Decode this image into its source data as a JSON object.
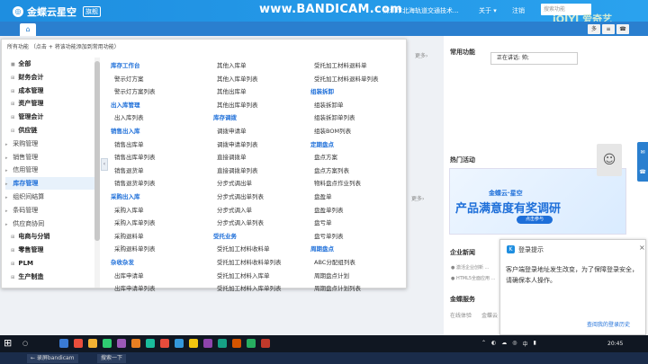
{
  "header": {
    "logo": "金蝶云星空",
    "badge": "旗舰",
    "recorder_watermark": "www.BANDICAM.com",
    "company": "深圳市北海轨道交通技术...",
    "about": "关于 ▾",
    "logout": "注销",
    "search_placeholder": "搜索功能",
    "video_watermark": "iQIYI 爱奇艺"
  },
  "tabbar": {
    "home_icon": "home-icon",
    "tool_labels": [
      "多",
      "≡",
      "☎"
    ]
  },
  "right_panel": {
    "common_title": "常用功能",
    "call_text": "正在讲话: 帅;",
    "more_label": "更多›",
    "hot_title": "热门活动",
    "banner_logo": "金蝶云·星空",
    "banner_text": "产品满意度有奖调研",
    "banner_btn": "点击参与",
    "news_title": "企业新闻",
    "news_items": [
      "● 激活企业创新 ...",
      "● HTML5全面应用 ..."
    ],
    "service_title": "金蝶服务",
    "service_items": [
      "在线体验",
      "金蝶云"
    ]
  },
  "popup": {
    "title": "登录提示",
    "close": "×",
    "body": "客户端登录地址发生改变，为了保障登录安全，请确保本人操作。",
    "link": "查阅我的登录历史"
  },
  "menu_panel": {
    "hint": "所有功能  （点击 + 将该功能添加到常用功能）",
    "nav": [
      {
        "label": "全部",
        "level": "child",
        "mark": "■"
      },
      {
        "label": "财务会计",
        "level": "child",
        "mark": "⊞"
      },
      {
        "label": "成本管理",
        "level": "child",
        "mark": "⊞"
      },
      {
        "label": "资产管理",
        "level": "child",
        "mark": "⊞"
      },
      {
        "label": "管理会计",
        "level": "child",
        "mark": "⊞"
      },
      {
        "label": "供应链",
        "level": "child",
        "mark": "⊟"
      },
      {
        "label": "采购管理",
        "level": "top",
        "mark": "▸"
      },
      {
        "label": "销售管理",
        "level": "top",
        "mark": "▸"
      },
      {
        "label": "信用管理",
        "level": "top",
        "mark": "▸"
      },
      {
        "label": "库存管理",
        "level": "active",
        "mark": "▸"
      },
      {
        "label": "组织间结算",
        "level": "top",
        "mark": "▸"
      },
      {
        "label": "条码管理",
        "level": "top",
        "mark": "▸"
      },
      {
        "label": "供应商协同",
        "level": "top",
        "mark": "▸"
      },
      {
        "label": "电商与分销",
        "level": "child",
        "mark": "⊞"
      },
      {
        "label": "零售管理",
        "level": "child",
        "mark": "⊞"
      },
      {
        "label": "PLM",
        "level": "child",
        "mark": "⊞"
      },
      {
        "label": "生产制造",
        "level": "child",
        "mark": "⊞"
      }
    ],
    "columns": [
      [
        {
          "t": "head",
          "label": "库存工作台"
        },
        {
          "t": "link",
          "label": "警示灯方案"
        },
        {
          "t": "link",
          "label": "警示灯方案列表"
        },
        {
          "t": "head",
          "label": "出入库管理"
        },
        {
          "t": "link",
          "label": "出入库列表"
        },
        {
          "t": "head",
          "label": "销售出入库"
        },
        {
          "t": "link",
          "label": "销售出库单"
        },
        {
          "t": "link",
          "label": "销售出库单列表"
        },
        {
          "t": "link",
          "label": "销售退货单"
        },
        {
          "t": "link",
          "label": "销售退货单列表"
        },
        {
          "t": "head",
          "label": "采购出入库"
        },
        {
          "t": "link",
          "label": "采购入库单"
        },
        {
          "t": "link",
          "label": "采购入库单列表"
        },
        {
          "t": "link",
          "label": "采购退料单"
        },
        {
          "t": "link",
          "label": "采购退料单列表"
        },
        {
          "t": "head",
          "label": "杂收杂发"
        },
        {
          "t": "link",
          "label": "出库申请单"
        },
        {
          "t": "link",
          "label": "出库申请单列表"
        }
      ],
      [
        {
          "t": "link",
          "label": "其他入库单"
        },
        {
          "t": "link",
          "label": "其他入库单列表"
        },
        {
          "t": "link",
          "label": "其他出库单"
        },
        {
          "t": "link",
          "label": "其他出库单列表"
        },
        {
          "t": "head",
          "label": "库存调拨"
        },
        {
          "t": "link",
          "label": "调拨申请单"
        },
        {
          "t": "link",
          "label": "调拨申请单列表"
        },
        {
          "t": "link",
          "label": "直接调拨单"
        },
        {
          "t": "link",
          "label": "直接调拨单列表"
        },
        {
          "t": "link",
          "label": "分步式调出单"
        },
        {
          "t": "link",
          "label": "分步式调出单列表"
        },
        {
          "t": "link",
          "label": "分步式调入单"
        },
        {
          "t": "link",
          "label": "分步式调入单列表"
        },
        {
          "t": "head",
          "label": "受托业务"
        },
        {
          "t": "link",
          "label": "受托加工材料收料单"
        },
        {
          "t": "link",
          "label": "受托加工材料收料单列表"
        },
        {
          "t": "link",
          "label": "受托加工材料入库单"
        },
        {
          "t": "link",
          "label": "受托加工材料入库单列表"
        }
      ],
      [
        {
          "t": "link",
          "label": "受托加工材料退料单"
        },
        {
          "t": "link",
          "label": "受托加工材料退料单列表"
        },
        {
          "t": "head",
          "label": "组装拆卸"
        },
        {
          "t": "link",
          "label": "组装拆卸单"
        },
        {
          "t": "link",
          "label": "组装拆卸单列表"
        },
        {
          "t": "link",
          "label": "组装BOM列表"
        },
        {
          "t": "head",
          "label": "定期盘点"
        },
        {
          "t": "link",
          "label": "盘点方案"
        },
        {
          "t": "link",
          "label": "盘点方案列表"
        },
        {
          "t": "link",
          "label": "物料盘点作业列表"
        },
        {
          "t": "link",
          "label": "盘盈单"
        },
        {
          "t": "link",
          "label": "盘盈单列表"
        },
        {
          "t": "link",
          "label": "盘亏单"
        },
        {
          "t": "link",
          "label": "盘亏单列表"
        },
        {
          "t": "head",
          "label": "周期盘点"
        },
        {
          "t": "link",
          "label": "ABC分配组列表"
        },
        {
          "t": "link",
          "label": "周期盘点计划"
        },
        {
          "t": "link",
          "label": "周期盘点计划列表"
        }
      ]
    ]
  },
  "taskbar": {
    "start_icon": "windows-icon",
    "search_label": "○",
    "app_colors": [
      "#3a7bd5",
      "#e94e3c",
      "#f2b233",
      "#2ecc71",
      "#9b59b6",
      "#e67e22",
      "#1abc9c",
      "#e74c3c",
      "#3498db",
      "#f1c40f",
      "#8e44ad",
      "#16a085",
      "#d35400",
      "#27ae60",
      "#c0392b"
    ],
    "tray_items": [
      "⌃",
      "◐",
      "☁",
      "◎",
      "中",
      "▮"
    ],
    "clock": "20:45"
  },
  "footer": {
    "items": [
      "← 录屏bandicam",
      "搜索一下"
    ]
  },
  "colors": {
    "brand": "#1e8ee0",
    "link": "#1e6fd9",
    "active_bg": "#e7f1fb"
  }
}
